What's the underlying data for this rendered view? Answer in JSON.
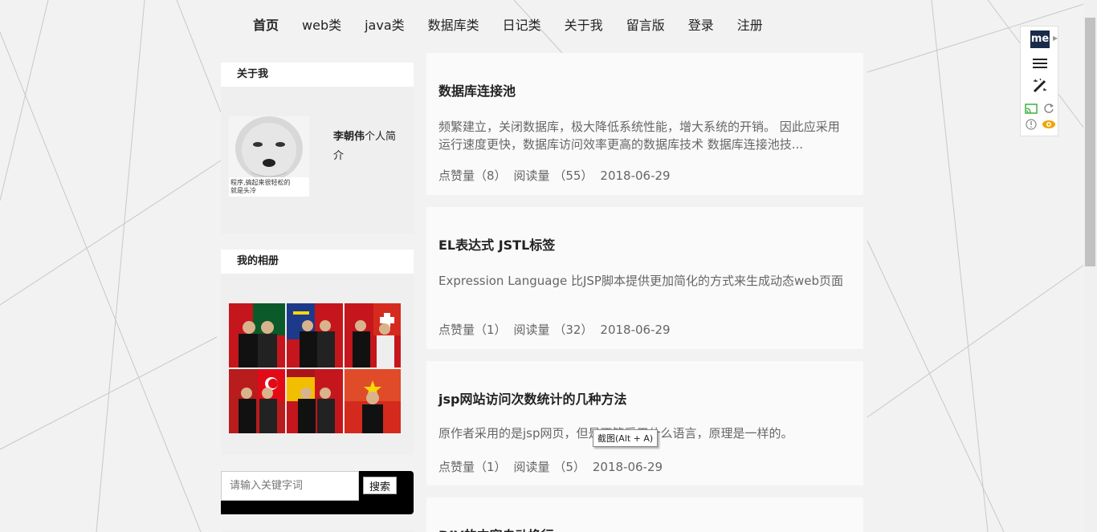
{
  "nav": {
    "items": [
      "首页",
      "web类",
      "java类",
      "数据库类",
      "日记类",
      "关于我",
      "留言版",
      "登录",
      "注册"
    ]
  },
  "sidebar": {
    "about": {
      "title": "关于我",
      "name": "李朝伟",
      "intro_suffix": "个人简介",
      "avatar_caption_1": "程序,搞起来很轻松的",
      "avatar_caption_2": "就是头冷"
    },
    "album": {
      "title": "我的相册",
      "photo_count": 6
    },
    "search": {
      "placeholder": "请输入关键字词",
      "button_label": "搜索"
    }
  },
  "posts": [
    {
      "title": "数据库连接池",
      "excerpt": "频繁建立，关闭数据库，极大降低系统性能，增大系统的开销。 因此应采用运行速度更快，数据库访问效率更高的数据库技术 数据库连接池技...",
      "likes_label": "点赞量（8）",
      "reads_label": "阅读量 （55）",
      "date": "2018-06-29"
    },
    {
      "title": "EL表达式 JSTL标签",
      "excerpt": "Expression Language 比JSP脚本提供更加简化的方式来生成动态web页面",
      "likes_label": "点赞量（1）",
      "reads_label": "阅读量 （32）",
      "date": "2018-06-29"
    },
    {
      "title": "jsp网站访问次数统计的几种方法",
      "excerpt": "原作者采用的是jsp网页，但是不管采用什么语言，原理是一样的。",
      "likes_label": "点赞量（1）",
      "reads_label": "阅读量 （5）",
      "date": "2018-06-29"
    },
    {
      "title": "DIV的内容自动换行"
    }
  ],
  "tooltip": "截图(Alt + A)",
  "extension": {
    "logo_text": "me",
    "icons": [
      "me-logo-icon",
      "menu-icon",
      "magic-wand-icon",
      "cast-icon",
      "refresh-icon",
      "info-icon",
      "eye-icon"
    ]
  },
  "colors": {
    "background": "#f2f2f2",
    "card": "#fafafa",
    "ext_logo": "#1a2b4a",
    "eye": "#f0a500",
    "cast": "#3cb043"
  }
}
